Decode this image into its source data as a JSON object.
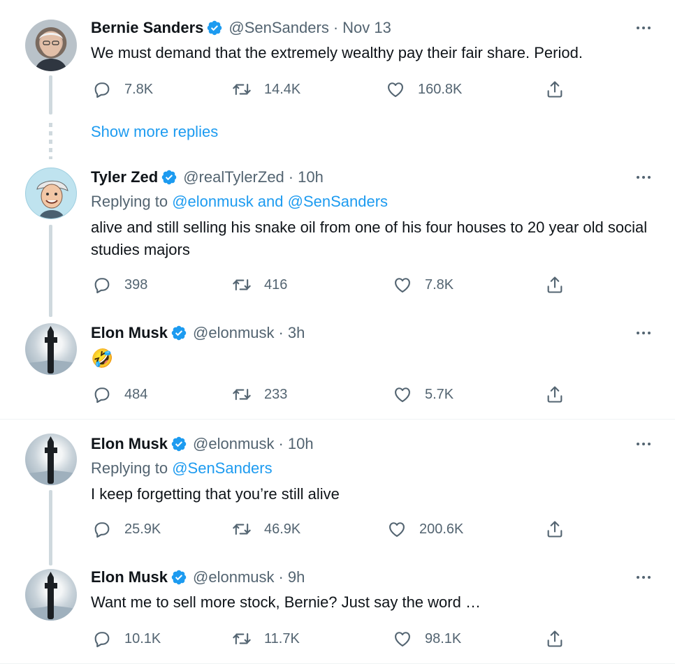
{
  "tweets": [
    {
      "name": "Bernie Sanders",
      "handle": "@SenSanders",
      "sep": "·",
      "time": "Nov 13",
      "reply_prefix": "",
      "reply_targets": "",
      "text": "We must demand that the extremely wealthy pay their fair share. Period.",
      "replies": "7.8K",
      "retweets": "14.4K",
      "likes": "160.8K"
    },
    {
      "name": "Tyler Zed",
      "handle": "@realTylerZed",
      "sep": "·",
      "time": "10h",
      "reply_prefix": "Replying to",
      "reply_targets": "@elonmusk and @SenSanders",
      "text": "alive and still selling his snake oil from one of his four houses to 20 year old social studies majors",
      "replies": "398",
      "retweets": "416",
      "likes": "7.8K"
    },
    {
      "name": "Elon Musk",
      "handle": "@elonmusk",
      "sep": "·",
      "time": "3h",
      "text": "🤣",
      "replies": "484",
      "retweets": "233",
      "likes": "5.7K"
    },
    {
      "name": "Elon Musk",
      "handle": "@elonmusk",
      "sep": "·",
      "time": "10h",
      "reply_prefix": "Replying to",
      "reply_targets": "@SenSanders",
      "text": "I keep forgetting that you’re still alive",
      "replies": "25.9K",
      "retweets": "46.9K",
      "likes": "200.6K"
    },
    {
      "name": "Elon Musk",
      "handle": "@elonmusk",
      "sep": "·",
      "time": "9h",
      "text": "Want me to sell more stock, Bernie? Just say the word …",
      "replies": "10.1K",
      "retweets": "11.7K",
      "likes": "98.1K"
    }
  ],
  "show_more_replies": "Show more replies",
  "colors": {
    "accent": "#1d9bf0",
    "muted": "#536471",
    "text": "#0f1419",
    "line": "#cfd9de"
  },
  "icons": {
    "verified": "verified-badge-icon",
    "reply": "reply-bubble-icon",
    "retweet": "retweet-icon",
    "like": "heart-icon",
    "share": "share-icon",
    "more": "more-dots-icon"
  }
}
